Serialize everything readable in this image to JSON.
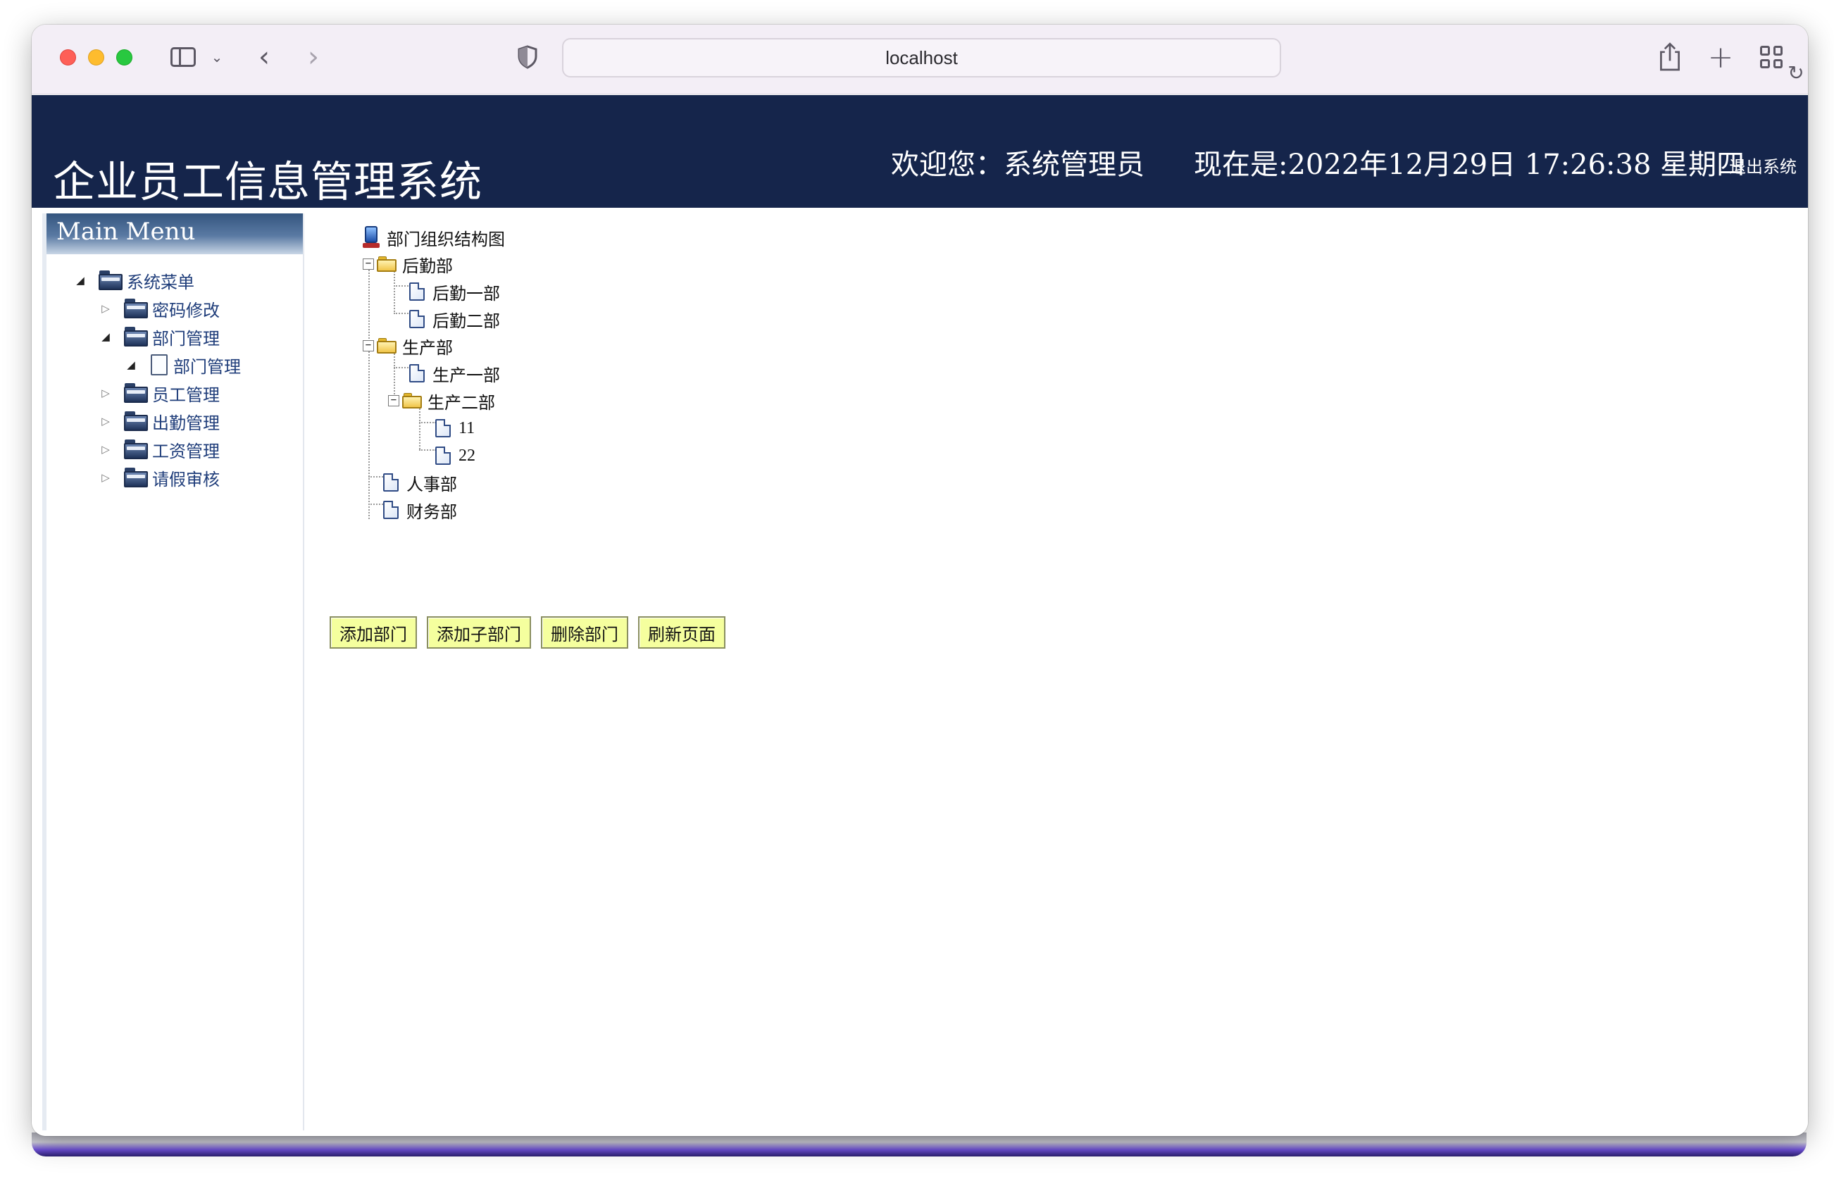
{
  "browser": {
    "url": "localhost"
  },
  "header": {
    "title": "企业员工信息管理系统",
    "welcome": "欢迎您：系统管理员",
    "datetime": "现在是:2022年12月29日 17:26:38 星期四",
    "logout": "退出系统"
  },
  "menu": {
    "heading": "Main Menu",
    "items": [
      {
        "label": "系统菜单"
      },
      {
        "label": "密码修改"
      },
      {
        "label": "部门管理"
      },
      {
        "label": "部门管理"
      },
      {
        "label": "员工管理"
      },
      {
        "label": "出勤管理"
      },
      {
        "label": "工资管理"
      },
      {
        "label": "请假审核"
      }
    ]
  },
  "dept_tree": {
    "root": "部门组织结构图",
    "nodes": [
      {
        "label": "后勤部"
      },
      {
        "label": "后勤一部"
      },
      {
        "label": "后勤二部"
      },
      {
        "label": "生产部"
      },
      {
        "label": "生产一部"
      },
      {
        "label": "生产二部"
      },
      {
        "label": "11"
      },
      {
        "label": "22"
      },
      {
        "label": "人事部"
      },
      {
        "label": "财务部"
      }
    ]
  },
  "actions": {
    "add_dept": "添加部门",
    "add_sub_dept": "添加子部门",
    "delete_dept": "删除部门",
    "refresh": "刷新页面"
  },
  "colors": {
    "banner": "#15254b",
    "button": "#f5ff9e"
  }
}
